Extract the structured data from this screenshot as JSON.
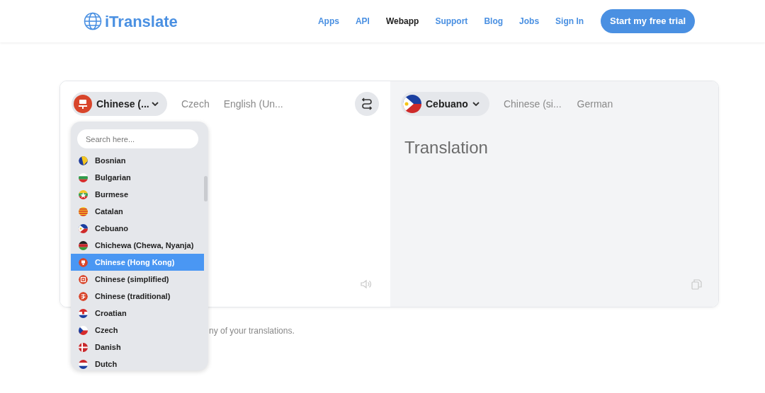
{
  "header": {
    "logo": "iTranslate",
    "nav": [
      {
        "label": "Apps",
        "selected": false
      },
      {
        "label": "API",
        "selected": false
      },
      {
        "label": "Webapp",
        "selected": true
      },
      {
        "label": "Support",
        "selected": false
      },
      {
        "label": "Blog",
        "selected": false
      },
      {
        "label": "Jobs",
        "selected": false
      },
      {
        "label": "Sign In",
        "selected": false
      }
    ],
    "cta": "Start my free trial"
  },
  "source": {
    "current": "Chinese (...",
    "recent": [
      "Czech",
      "English (Un..."
    ],
    "dropdown": {
      "placeholder": "Search here...",
      "items": [
        {
          "label": "Bosnian",
          "selected": false
        },
        {
          "label": "Bulgarian",
          "selected": false
        },
        {
          "label": "Burmese",
          "selected": false
        },
        {
          "label": "Catalan",
          "selected": false
        },
        {
          "label": "Cebuano",
          "selected": false
        },
        {
          "label": "Chichewa (Chewa, Nyanja)",
          "selected": false
        },
        {
          "label": "Chinese (Hong Kong)",
          "selected": true
        },
        {
          "label": "Chinese (simplified)",
          "selected": false
        },
        {
          "label": "Chinese (traditional)",
          "selected": false
        },
        {
          "label": "Croatian",
          "selected": false
        },
        {
          "label": "Czech",
          "selected": false
        },
        {
          "label": "Danish",
          "selected": false
        },
        {
          "label": "Dutch",
          "selected": false
        }
      ]
    }
  },
  "target": {
    "current": "Cebuano",
    "recent": [
      "Chinese (si...",
      "German"
    ],
    "placeholder": "Translation"
  },
  "footnote": "ny of your translations."
}
